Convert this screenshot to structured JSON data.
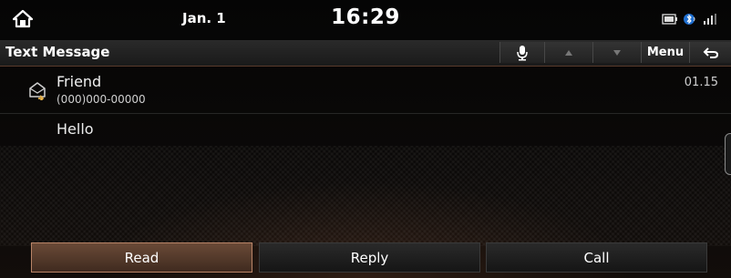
{
  "status_bar": {
    "date": "Jan. 1",
    "time": "16:29",
    "icons": [
      "home-icon",
      "battery-icon",
      "bluetooth-icon",
      "signal-icon"
    ]
  },
  "header": {
    "title": "Text Message",
    "buttons": {
      "voice_icon": "microphone-icon",
      "up_icon": "up-arrow-icon",
      "down_icon": "down-arrow-icon",
      "menu_label": "Menu",
      "back_icon": "back-icon"
    }
  },
  "message": {
    "sender": "Friend",
    "number": "(000)000-00000",
    "date": "01.15",
    "icon": "envelope-icon",
    "body": "Hello"
  },
  "bottom_buttons": [
    {
      "label": "Read",
      "active": true
    },
    {
      "label": "Reply",
      "active": false
    },
    {
      "label": "Call",
      "active": false
    }
  ],
  "colors": {
    "accent": "#b98467",
    "background": "#000000",
    "text": "#e8e8e8"
  }
}
